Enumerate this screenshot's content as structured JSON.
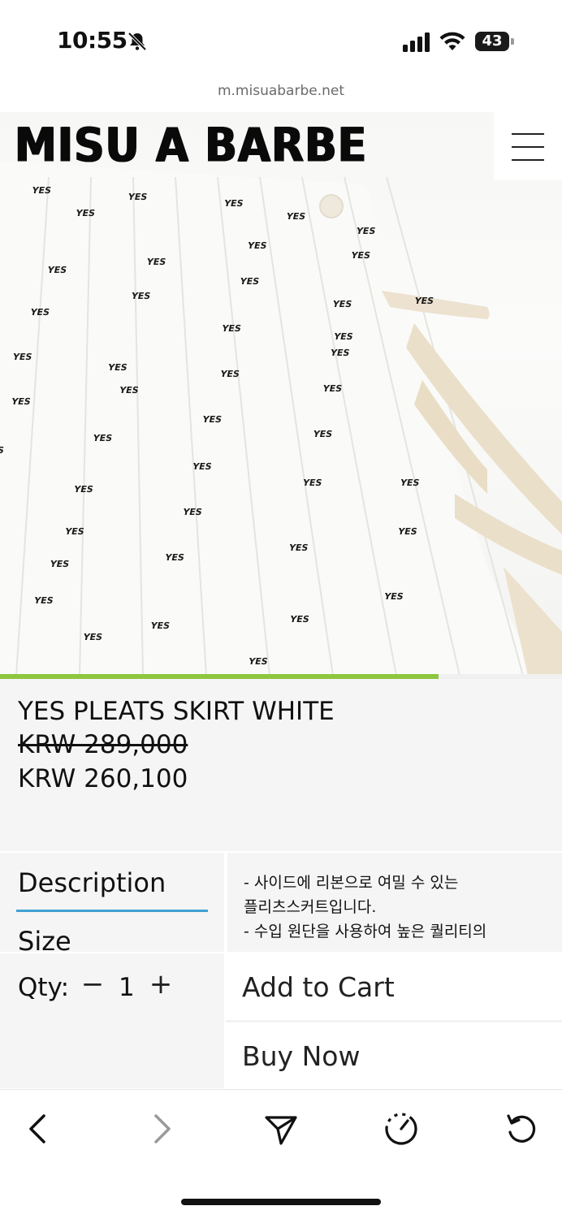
{
  "status_bar": {
    "time": "10:55",
    "battery": "43"
  },
  "browser": {
    "url": "m.misuabarbe.net"
  },
  "site": {
    "brand": "MISU A BARBE"
  },
  "gallery": {
    "pattern_text": "YES",
    "progress_fraction": 0.78,
    "accent_color": "#8dc63f"
  },
  "product": {
    "name": "YES PLEATS SKIRT WHITE",
    "original_price": "KRW 289,000",
    "sale_price": "KRW 260,100"
  },
  "tabs": {
    "description": "Description",
    "size": "Size",
    "active_color": "#3fa0d2"
  },
  "description_lines": [
    "- 사이드에 리본으로 여밀 수 있는",
    "플리츠스커트입니다.",
    "- 수입 원단을 사용하여 높은 퀄리티의"
  ],
  "purchase": {
    "qty_label": "Qty:",
    "qty_minus": "−",
    "qty_value": "1",
    "qty_plus": "+",
    "add_to_cart": "Add to Cart",
    "buy_now": "Buy Now"
  },
  "toolbar": {
    "icons": [
      "back-icon",
      "forward-icon",
      "share-icon",
      "speed-icon",
      "reload-icon"
    ]
  }
}
